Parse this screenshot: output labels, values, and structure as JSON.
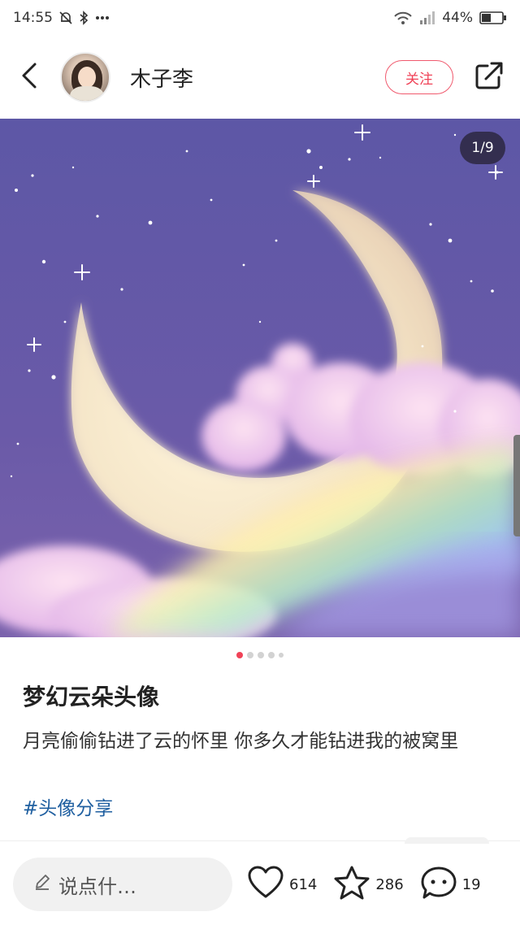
{
  "status_bar": {
    "time": "14:55",
    "battery": "44%",
    "icons": [
      "silent-bell-icon",
      "bluetooth-icon",
      "more-dots-icon",
      "wifi-icon",
      "signal-icon",
      "battery-icon"
    ]
  },
  "header": {
    "username": "木子李",
    "follow_label": "关注",
    "icons": [
      "back-arrow-icon",
      "share-icon"
    ]
  },
  "carousel": {
    "page_indicator": "1/9",
    "current_index": 1,
    "total": 9,
    "visible_dots": 5
  },
  "post": {
    "title": "梦幻云朵头像",
    "body": "月亮偷偷钻进了云的怀里 你多久才能钻进我的被窝里",
    "hashtag": "#头像分享"
  },
  "bottom_bar": {
    "comment_placeholder": "说点什…",
    "likes": "614",
    "collects": "286",
    "comments": "19",
    "icons": [
      "pencil-icon",
      "heart-icon",
      "star-icon",
      "comment-bubble-icon"
    ]
  },
  "colors": {
    "accent": "#f04257",
    "hashtag": "#1f5fa0",
    "sky": "#5a4e92"
  }
}
